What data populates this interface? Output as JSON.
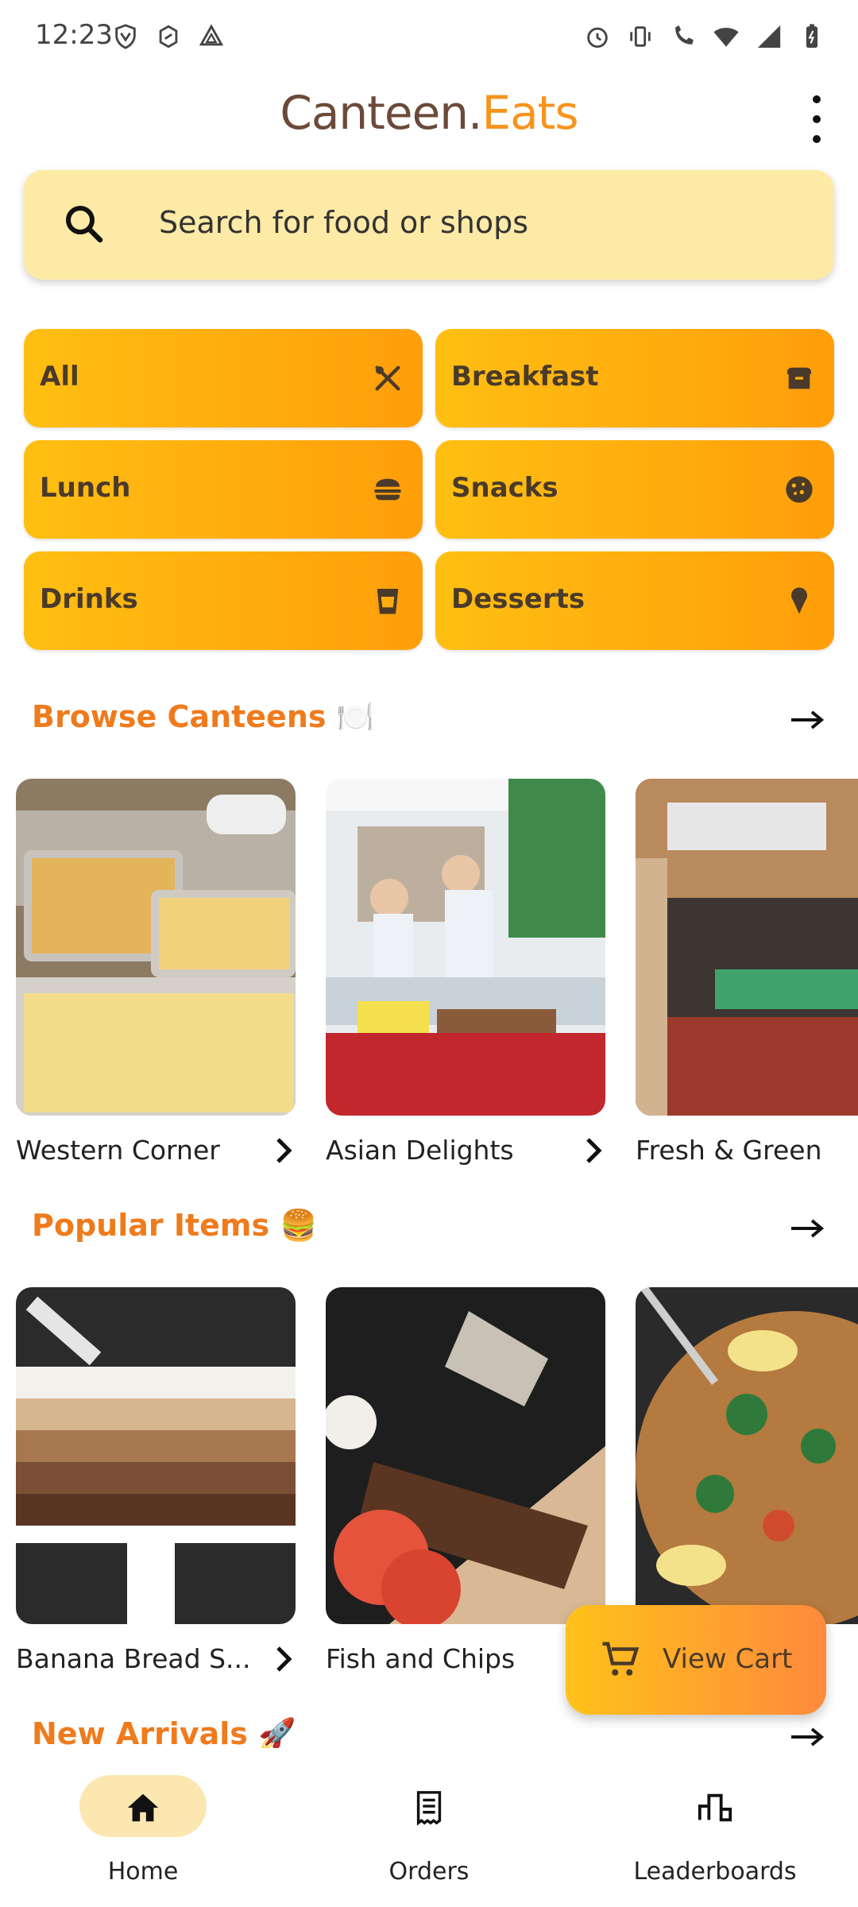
{
  "status_bar": {
    "time": "12:23"
  },
  "header": {
    "brand_main": "Canteen.",
    "brand_accent": "Eats"
  },
  "search": {
    "placeholder": "Search for food or shops"
  },
  "categories": [
    {
      "label": "All",
      "icon": "utensils-icon"
    },
    {
      "label": "Breakfast",
      "icon": "toaster-icon"
    },
    {
      "label": "Lunch",
      "icon": "burger-icon"
    },
    {
      "label": "Snacks",
      "icon": "cookie-icon"
    },
    {
      "label": "Drinks",
      "icon": "cup-icon"
    },
    {
      "label": "Desserts",
      "icon": "ice-cream-icon"
    }
  ],
  "sections": {
    "canteens": {
      "title": "Browse Canteens 🍽️",
      "items": [
        "Western Corner",
        "Asian Delights",
        "Fresh & Green"
      ]
    },
    "popular": {
      "title": "Popular Items 🍔",
      "items": [
        "Banana Bread S...",
        "Fish and Chips",
        ""
      ]
    },
    "new_arrivals": {
      "title": "New Arrivals 🚀"
    }
  },
  "view_cart": {
    "label": "View Cart"
  },
  "bottom_nav": [
    {
      "label": "Home",
      "active": true
    },
    {
      "label": "Orders",
      "active": false
    },
    {
      "label": "Leaderboards",
      "active": false
    }
  ],
  "colors": {
    "accent": "#ef7b1d",
    "brand_text": "#6b4a3a",
    "search_bg": "#fdeaa6",
    "category_start": "#ffbf12",
    "category_end": "#ff9e0a"
  }
}
